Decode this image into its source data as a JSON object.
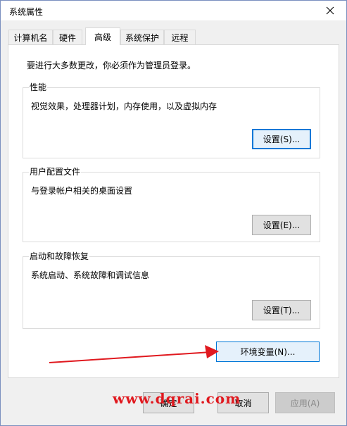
{
  "window": {
    "title": "系统属性"
  },
  "tabs": [
    {
      "label": "计算机名",
      "active": false
    },
    {
      "label": "硬件",
      "active": false
    },
    {
      "label": "高级",
      "active": true
    },
    {
      "label": "系统保护",
      "active": false
    },
    {
      "label": "远程",
      "active": false
    }
  ],
  "advanced": {
    "admin_note": "要进行大多数更改，你必须作为管理员登录。",
    "groups": [
      {
        "title": "性能",
        "description": "视觉效果，处理器计划，内存使用，以及虚拟内存",
        "button": "设置(S)..."
      },
      {
        "title": "用户配置文件",
        "description": "与登录帐户相关的桌面设置",
        "button": "设置(E)..."
      },
      {
        "title": "启动和故障恢复",
        "description": "系统启动、系统故障和调试信息",
        "button": "设置(T)..."
      }
    ],
    "env_button": "环境变量(N)..."
  },
  "footer": {
    "ok": "确定",
    "cancel": "取消",
    "apply": "应用(A)"
  },
  "watermark": "www.dqrai.com",
  "colors": {
    "accent": "#0078d7",
    "arrow": "#e0191f",
    "watermark": "#e0191f"
  },
  "icons": {
    "close": "close-icon"
  }
}
